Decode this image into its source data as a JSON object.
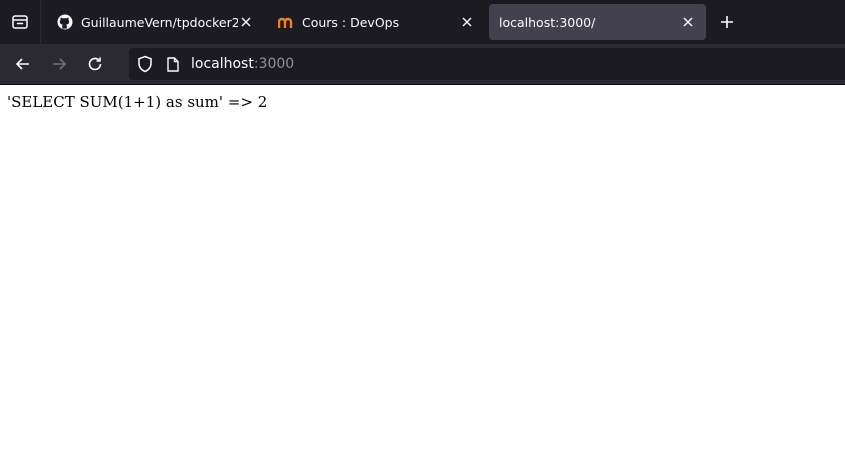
{
  "browser": {
    "tabs": [
      {
        "title": "GuillaumeVern/tpdocker2",
        "favicon": "github-icon",
        "active": false
      },
      {
        "title": "Cours : DevOps",
        "favicon": "moodle-icon",
        "active": false
      },
      {
        "title": "localhost:3000/",
        "favicon": "none",
        "active": true
      }
    ],
    "url": {
      "host": "localhost",
      "port": ":3000"
    }
  },
  "page": {
    "text": "'SELECT SUM(1+1) as sum' => 2"
  },
  "colors": {
    "tabbar_bg": "#1c1b22",
    "active_tab_bg": "#42414d",
    "navbar_bg": "#2b2a33",
    "moodle_orange": "#f98012"
  }
}
